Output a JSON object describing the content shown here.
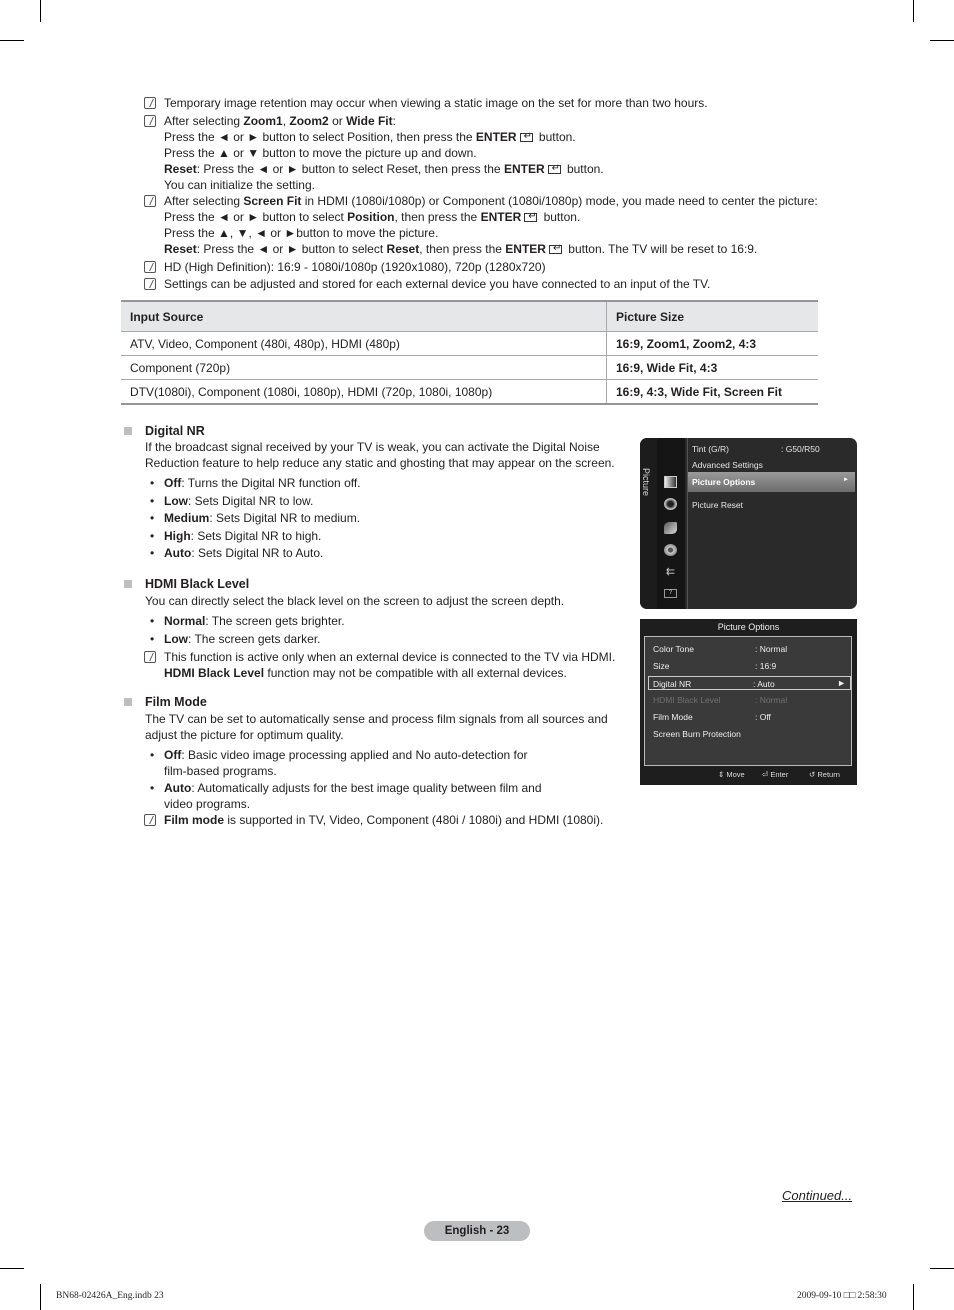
{
  "notes_top": [
    {
      "lines": [
        [
          {
            "t": "Temporary image retention may occur when viewing a static image on the set for more than two hours."
          }
        ]
      ]
    },
    {
      "lines": [
        [
          {
            "t": "After selecting "
          },
          {
            "b": "Zoom1"
          },
          {
            "t": ", "
          },
          {
            "b": "Zoom2"
          },
          {
            "t": " or "
          },
          {
            "b": "Wide Fit"
          },
          {
            "t": ":"
          }
        ],
        [
          {
            "t": "Press the ◄ or ► button to select Position, then press the "
          },
          {
            "b": "ENTER"
          },
          {
            "enter": true
          },
          {
            "t": " button."
          }
        ],
        [
          {
            "t": "Press the ▲ or ▼ button to move the picture up and down."
          }
        ],
        [
          {
            "b": "Reset"
          },
          {
            "t": ": Press the ◄ or ► button to select Reset, then press the "
          },
          {
            "b": "ENTER"
          },
          {
            "enter": true
          },
          {
            "t": " button."
          }
        ],
        [
          {
            "t": "You can initialize the setting."
          }
        ]
      ]
    },
    {
      "lines": [
        [
          {
            "t": "After selecting "
          },
          {
            "b": "Screen Fit"
          },
          {
            "t": " in HDMI (1080i/1080p) or Component (1080i/1080p) mode, you made need to center the picture:"
          }
        ],
        [
          {
            "t": "Press the ◄ or ► button to select "
          },
          {
            "b": "Position"
          },
          {
            "t": ", then press the "
          },
          {
            "b": "ENTER"
          },
          {
            "enter": true
          },
          {
            "t": " button."
          }
        ],
        [
          {
            "t": "Press the ▲, ▼, ◄ or ►button to move the picture."
          }
        ],
        [
          {
            "b": "Reset"
          },
          {
            "t": ": Press the ◄ or ► button to select "
          },
          {
            "b": "Reset"
          },
          {
            "t": ", then press the "
          },
          {
            "b": "ENTER"
          },
          {
            "enter": true
          },
          {
            "t": " button. The TV will be reset to 16:9."
          }
        ]
      ]
    },
    {
      "lines": [
        [
          {
            "t": "HD (High Definition): 16:9 - 1080i/1080p (1920x1080), 720p (1280x720)"
          }
        ]
      ]
    },
    {
      "lines": [
        [
          {
            "t": "Settings can be adjusted and stored for each external device you have connected to an input of the TV."
          }
        ]
      ]
    }
  ],
  "table": {
    "headers": [
      "Input Source",
      "Picture Size"
    ],
    "rows": [
      [
        "ATV, Video, Component (480i, 480p), HDMI (480p)",
        "16:9, Zoom1, Zoom2, 4:3"
      ],
      [
        "Component (720p)",
        "16:9, Wide Fit, 4:3"
      ],
      [
        "DTV(1080i), Component (1080i, 1080p), HDMI (720p, 1080i, 1080p)",
        "16:9, 4:3, Wide Fit, Screen Fit"
      ]
    ]
  },
  "digital_nr": {
    "title": "Digital NR",
    "desc_lines": [
      "If the broadcast signal received by your TV is weak, you can activate the Digital Noise",
      "Reduction feature to help reduce any static and ghosting that may appear on the screen."
    ],
    "bullets": [
      {
        "b": "Off",
        "t": ": Turns the Digital NR function off."
      },
      {
        "b": "Low",
        "t": ": Sets Digital NR to low."
      },
      {
        "b": "Medium",
        "t": ": Sets Digital NR to medium."
      },
      {
        "b": "High",
        "t": ": Sets Digital NR to high."
      },
      {
        "b": "Auto",
        "t": ": Sets Digital NR to Auto."
      }
    ]
  },
  "hdmi_black": {
    "title": "HDMI Black Level",
    "desc": "You can directly select the black level on the screen to adjust the screen depth.",
    "bullets": [
      {
        "b": "Normal",
        "t": ": The screen gets brighter."
      },
      {
        "b": "Low",
        "t": ": The screen gets darker."
      }
    ],
    "note_line1": "This function is active only when an external device is connected to the TV via HDMI.",
    "note_line2_bold": "HDMI Black Level",
    "note_line2_rest": " function may not be compatible with all external devices."
  },
  "film_mode": {
    "title": "Film Mode",
    "desc_lines": [
      "The TV can be set to automatically sense and process film signals from all sources and",
      "adjust the picture for optimum quality."
    ],
    "bullet1_b": "Off",
    "bullet1_t": ": Basic video image processing applied and No auto-detection for",
    "bullet1_cont": "film-based programs.",
    "bullet2_b": "Auto",
    "bullet2_t": ": Automatically adjusts for the best image quality between film and",
    "bullet2_cont": "video programs.",
    "note_bold": "Film mode",
    "note_rest": " is supported in TV, Video, Component (480i / 1080i) and HDMI (1080i)."
  },
  "osd_picture": {
    "side_label": "Picture",
    "items": [
      {
        "label": "Tint (G/R)",
        "value": ": G50/R50"
      },
      {
        "label": "Advanced Settings",
        "value": ""
      },
      {
        "label": "Picture Options",
        "value": "►",
        "selected": true
      },
      {
        "label": "Picture Reset",
        "value": ""
      }
    ]
  },
  "osd_options": {
    "title": "Picture Options",
    "items": [
      {
        "label": "Color Tone",
        "value": ": Normal"
      },
      {
        "label": "Size",
        "value": ": 16:9"
      },
      {
        "label": "Digital NR",
        "value": ": Auto",
        "arrow": "►"
      },
      {
        "label": "HDMI Black Level",
        "value": ": Normal"
      },
      {
        "label": "Film Mode",
        "value": ": Off"
      },
      {
        "label": "Screen Burn Protection",
        "value": ""
      }
    ],
    "footer": {
      "move": "Move",
      "enter": "Enter",
      "return": "Return"
    }
  },
  "continued": "Continued...",
  "page_label": "English - 23",
  "footer_left": "BN68-02426A_Eng.indb   23",
  "footer_right": "2009-09-10   □□ 2:58:30"
}
